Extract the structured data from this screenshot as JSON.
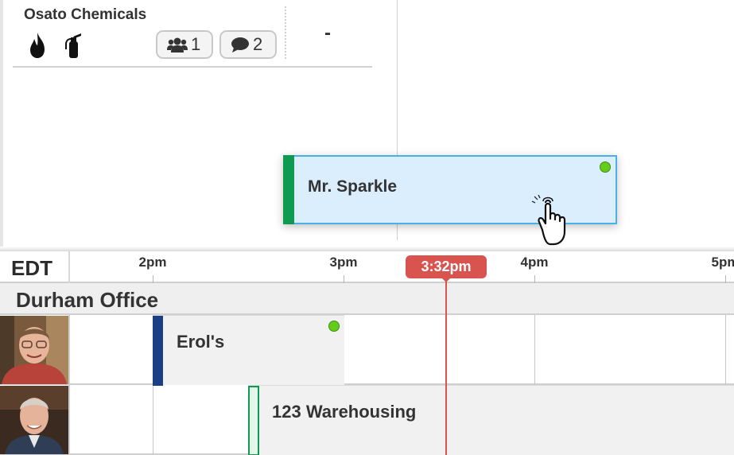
{
  "top_panel": {
    "job_card": {
      "company": "Osato Chemicals",
      "icons": [
        "fire-icon",
        "fire-extinguisher-icon"
      ],
      "people_count": "1",
      "comment_count": "2",
      "value": "-"
    }
  },
  "drag_block": {
    "label": "Mr. Sparkle",
    "stripe_color": "#0e9a50",
    "status_color": "#66cc1a"
  },
  "timeline": {
    "timezone": "EDT",
    "hours": [
      "2pm",
      "3pm",
      "4pm",
      "5pm"
    ],
    "current_time": "3:32pm",
    "current_time_color": "#d9534f"
  },
  "group": {
    "name": "Durham Office"
  },
  "rows": [
    {
      "avatar": "avatar-photo",
      "job": {
        "label": "Erol's",
        "stripe_color": "#1a3f82",
        "status_color": "#66cc1a"
      }
    },
    {
      "avatar": "avatar-photo",
      "job": {
        "label": "123 Warehousing",
        "stripe_color": "#0e9a50"
      }
    }
  ]
}
